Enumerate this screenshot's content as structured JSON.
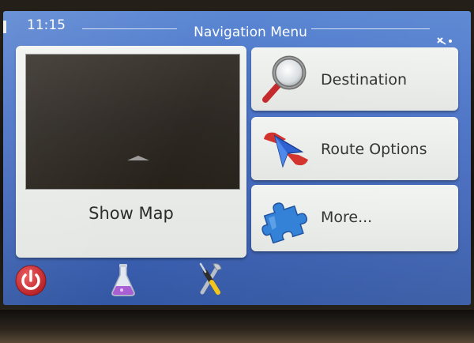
{
  "header": {
    "time": "11:15",
    "title": "Navigation Menu",
    "status_icon": "satellite-icon"
  },
  "map_tile": {
    "label": "Show Map"
  },
  "menu": {
    "destination": {
      "label": "Destination",
      "icon": "magnifier-icon"
    },
    "route_options": {
      "label": "Route Options",
      "icon": "route-arrow-icon"
    },
    "more": {
      "label": "More...",
      "icon": "puzzle-icon"
    }
  },
  "toolbar": {
    "icons": [
      "power-icon",
      "flask-icon",
      "tools-icon"
    ]
  },
  "colors": {
    "screen_bg": "#4a72c6",
    "tile_bg": "#eef0ee",
    "power_red": "#d8262b",
    "magnifier_red": "#c4282a",
    "puzzle_blue": "#2f7fd6"
  }
}
